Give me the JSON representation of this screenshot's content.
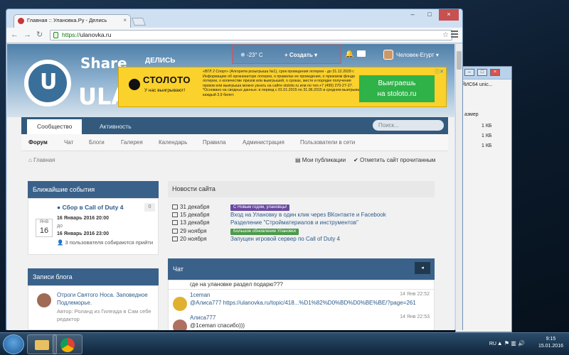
{
  "browser": {
    "tab_title": "Главная :: Улановка.Ру - Делись",
    "url_https": "https://",
    "url_host": "ulanovka.ru"
  },
  "background_window": {
    "address_text": "ЙИС64 unic...",
    "column_header": "азмер",
    "sizes": [
      "1 КБ",
      "1 КБ",
      "1 КБ"
    ]
  },
  "header": {
    "logo_share": "Share",
    "logo_delis": "ДЕЛИСЬ",
    "logo_name": "ULANC",
    "weather": "-23° C",
    "create_label": "Создать",
    "username": "Человек-Егурт"
  },
  "ad": {
    "brand": "СТОЛОТО",
    "slogan": "У нас выигрывают!",
    "text": "«ВГЛ 2 Спорт» (Алгоритм розыгрыша №1), срок проведения лотереи - до 31.12.2029 г. Информацию об организаторе лотереи, о правилах ее проведения, о призовом фонде лотереи, о количестве призов или выигрышей, о сроках, месте и порядке получения призов или выигрыша можно узнать на сайте stoloto.ru или по тел.+7 (499) 270-27-27. *Основано на сводных данных: в период с 01.01.2015 по 31.06.2015 в среднем выигрывал каждый 3,9 билет.",
    "cta_line1": "Выиграешь",
    "cta_line2": "на stoloto.ru"
  },
  "tabs": [
    "Сообщество",
    "Активность"
  ],
  "search_placeholder": "Поиск...",
  "subnav": [
    "Форум",
    "Чат",
    "Блоги",
    "Галерея",
    "Календарь",
    "Правила",
    "Администрация",
    "Пользователи в сети"
  ],
  "breadcrumb": {
    "home": "Главная",
    "my_posts": "Мои публикации",
    "mark_read": "Отметить сайт прочитанным"
  },
  "events": {
    "title": "Ближайшие события",
    "event_title": "Сбор в Call of Duty 4",
    "count": "0",
    "month": "ЯНВ",
    "day": "16",
    "start": "16 Январь 2016 20:00",
    "until": "до",
    "end": "16 Январь 2016 23:00",
    "going": "3 пользователя собираются прийти"
  },
  "blog": {
    "title": "Записи блога",
    "post_title": "Отроги Святого Носа. Заповедное Подлеморье.",
    "post_author": "Автор: Роланд из Гилеада в Сам себе редактор"
  },
  "news": {
    "title": "Новости сайта",
    "items": [
      {
        "date": "31 декабря",
        "badge": "С Новым годом, улановцы!",
        "text": ""
      },
      {
        "date": "15 декабря",
        "badge": "",
        "text": "Вход на Улановку в один клик через ВКонтакте и Facebook"
      },
      {
        "date": "13 декабря",
        "badge": "",
        "text": "Разделение \"Стройматериалов и инструментов\""
      },
      {
        "date": "29 ноября",
        "badge": "Большое обновление Улановки",
        "text": ""
      },
      {
        "date": "20 ноября",
        "badge": "",
        "text": "Запущен игровой сервер по Call of Duty 4"
      }
    ]
  },
  "chat": {
    "title": "Чат",
    "toggle": "◂",
    "first_line": "где на улановке раздел подарю???",
    "messages": [
      {
        "user": "1ceman",
        "time": "14 Янв 22:52",
        "text": "@Алиса777 https://ulanovka.ru/topic/418...%D1%82%D0%BD%D0%BE%BE/?page=261"
      },
      {
        "user": "Алиса777",
        "time": "14 Янв 22:53",
        "text": "@1ceman спасибо)))"
      }
    ]
  },
  "taskbar": {
    "lang": "RU",
    "time": "9:15",
    "date": "15.01.2016"
  }
}
